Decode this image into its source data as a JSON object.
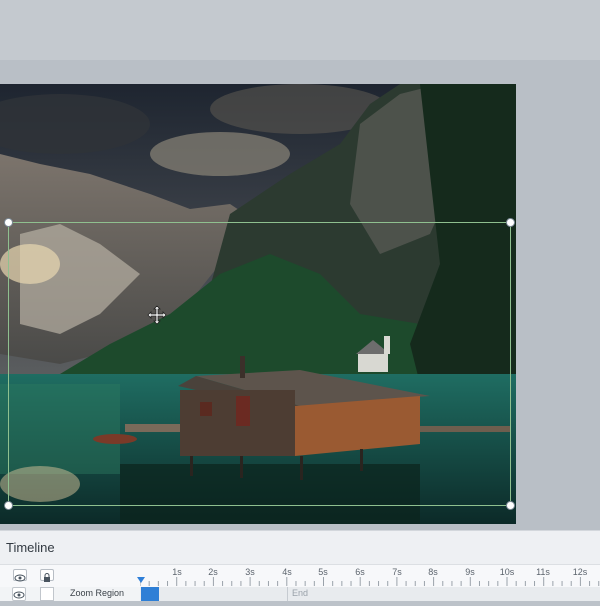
{
  "timeline": {
    "title": "Timeline",
    "ruler": [
      "1s",
      "2s",
      "3s",
      "4s",
      "5s",
      "6s",
      "7s",
      "8s",
      "9s",
      "10s",
      "11s",
      "12s"
    ],
    "track": {
      "name": "Zoom Region",
      "end_label": "End"
    }
  },
  "colors": {
    "accent": "#2e7fd6",
    "zoom_region_border": "#8fc08f",
    "canvas_bg": "#b9bfc6",
    "timeline_bg": "#eef0f3"
  },
  "icons": {
    "move": "move-cursor-icon",
    "visibility": "eye-icon",
    "lock": "lock-icon"
  }
}
